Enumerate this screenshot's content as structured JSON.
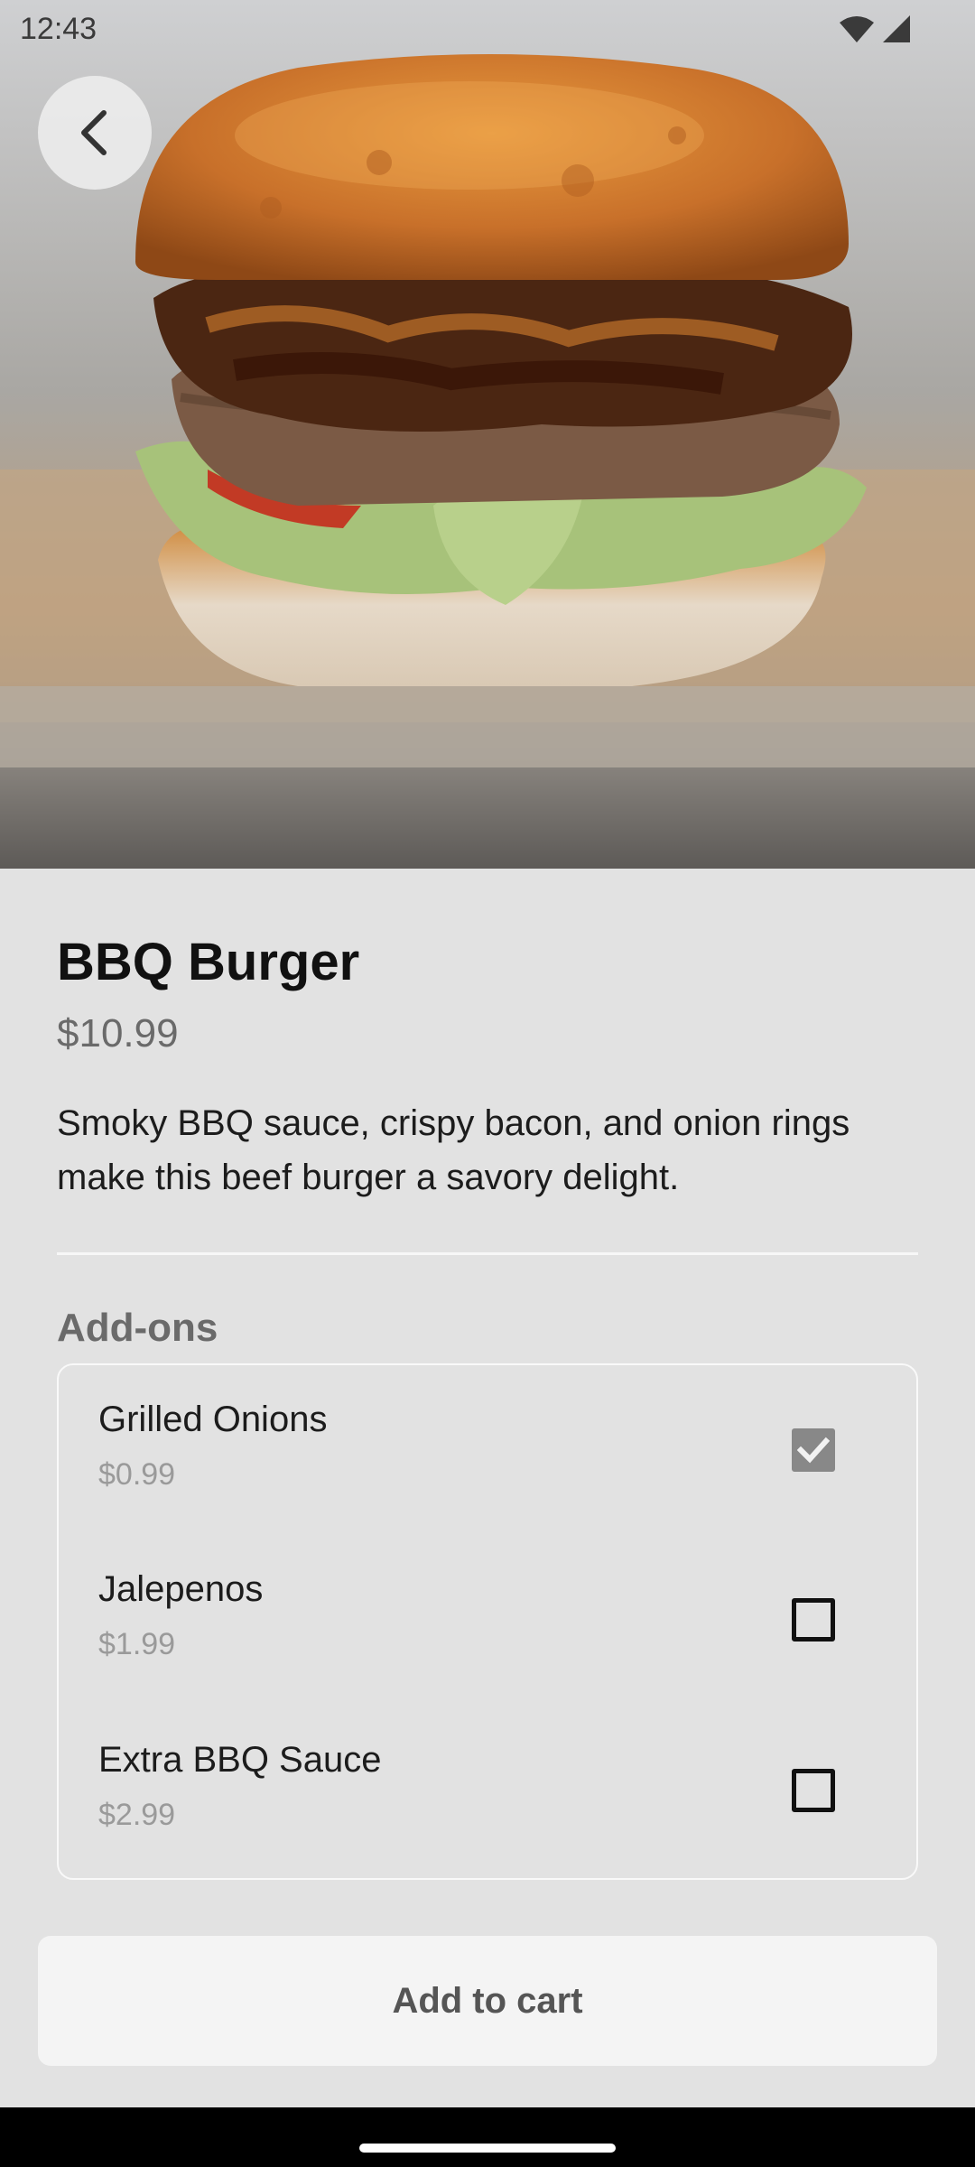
{
  "status_bar": {
    "time": "12:43"
  },
  "hero": {
    "image_subject": "bbq-burger-photo"
  },
  "product": {
    "name": "BBQ Burger",
    "price": "$10.99",
    "description": "Smoky BBQ sauce, crispy bacon, and onion rings make this beef burger a savory delight."
  },
  "addons": {
    "title": "Add-ons",
    "items": [
      {
        "name": "Grilled Onions",
        "price": "$0.99",
        "checked": true
      },
      {
        "name": "Jalepenos",
        "price": "$1.99",
        "checked": false
      },
      {
        "name": "Extra BBQ Sauce",
        "price": "$2.99",
        "checked": false
      }
    ]
  },
  "cart_button": {
    "label": "Add to cart"
  },
  "colors": {
    "background": "#e2e2e2",
    "checked": "#888888",
    "button": "#f4f4f4"
  }
}
